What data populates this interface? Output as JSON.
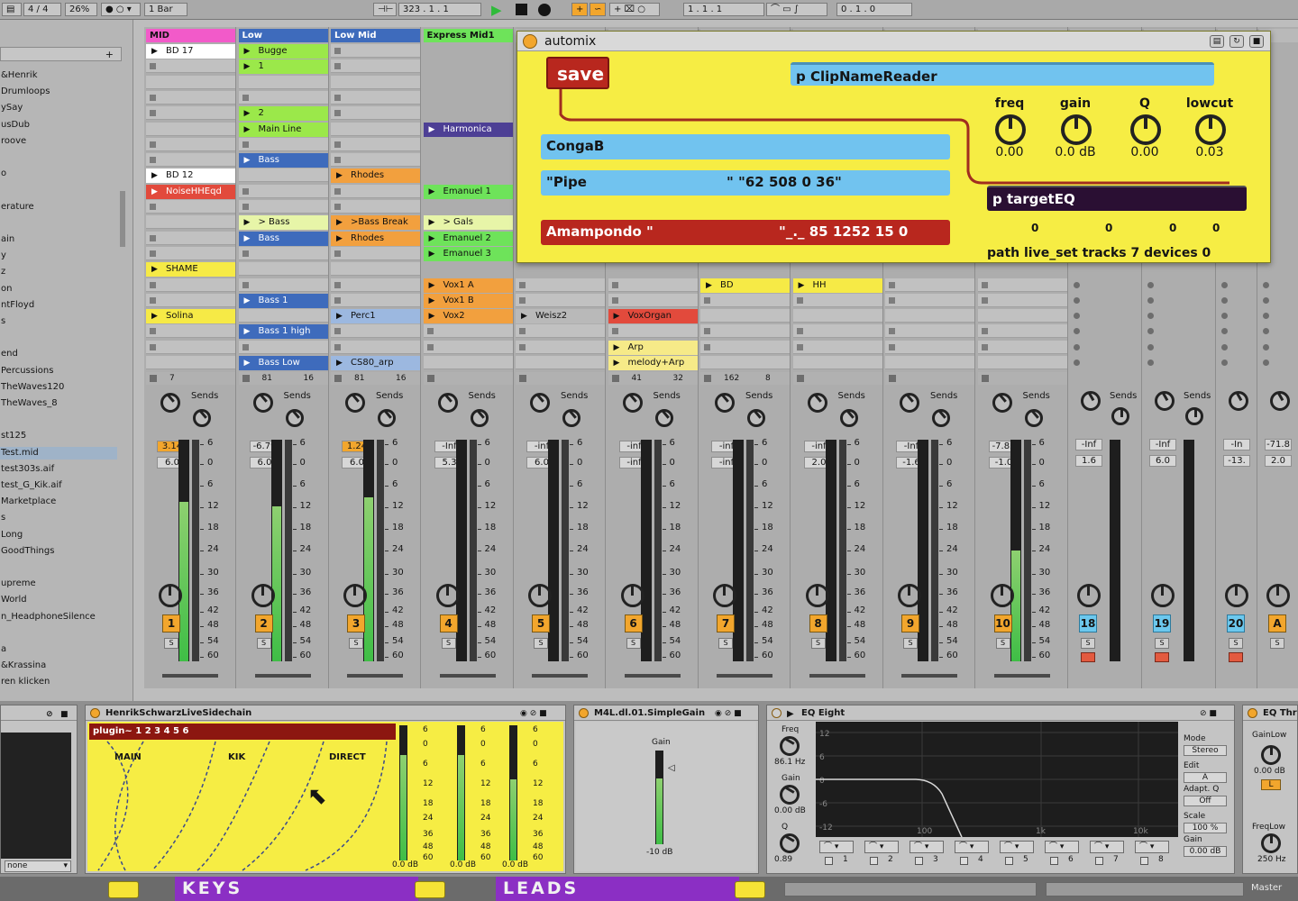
{
  "topbar": {
    "signature": "4 / 4",
    "zoom": "26%",
    "quantize": "1 Bar",
    "position": "323 .  1 .  1",
    "loop_start": "1 .  1 .  1",
    "loop_length": "0 .  1 .  0"
  },
  "browser": {
    "items": [
      "&Henrik",
      "Drumloops",
      "ySay",
      "usDub",
      "roove",
      "",
      "o",
      "",
      "erature",
      "",
      "ain",
      "y",
      "z",
      "on",
      "ntFloyd",
      "s",
      "",
      "end",
      "Percussions",
      "TheWaves120",
      "TheWaves_8",
      "",
      "st125",
      "Test.mid",
      "test303s.aif",
      "test_G_Kik.aif",
      "Marketplace",
      "s",
      "Long",
      "GoodThings",
      "",
      "upreme",
      "World",
      "n_HeadphoneSilence",
      "",
      "a",
      "&Krassina",
      "ren klicken"
    ],
    "selected_index": 23
  },
  "tracks": [
    {
      "name": "MID",
      "color": "#f25ac9",
      "clips": [
        {
          "row": 0,
          "label": "BD 17",
          "color": "#ffffff"
        },
        {
          "row": 8,
          "label": "BD 12",
          "color": "#ffffff"
        },
        {
          "row": 9,
          "label": "NoiseHHEqd",
          "color": "#e24a3c",
          "text": "#ffffff"
        },
        {
          "row": 14,
          "label": "SHAME",
          "color": "#f6ea46"
        },
        {
          "row": 17,
          "label": "Solina",
          "color": "#f6ea46"
        }
      ],
      "status": [
        "7",
        "",
        "",
        ""
      ],
      "vol": "3.14",
      "vol_orange": true,
      "send": "6.0",
      "num": "1",
      "meter": 0.72
    },
    {
      "name": "Low",
      "color": "#3e6bbc",
      "text": "#ffffff",
      "clips": [
        {
          "row": 0,
          "label": "Bugge",
          "color": "#9be84a"
        },
        {
          "row": 1,
          "label": "1",
          "color": "#9be84a"
        },
        {
          "row": 4,
          "label": "2",
          "color": "#9be84a"
        },
        {
          "row": 5,
          "label": "Main Line",
          "color": "#9be84a"
        },
        {
          "row": 7,
          "label": "Bass",
          "color": "#3e6bbc",
          "text": "#ffffff"
        },
        {
          "row": 11,
          "label": "> Bass",
          "color": "#e7f5a8"
        },
        {
          "row": 12,
          "label": "Bass",
          "color": "#3e6bbc",
          "text": "#ffffff"
        },
        {
          "row": 16,
          "label": "Bass 1",
          "color": "#3e6bbc",
          "text": "#ffffff"
        },
        {
          "row": 18,
          "label": "Bass 1 high",
          "color": "#3e6bbc",
          "text": "#ffffff"
        },
        {
          "row": 20,
          "label": "Bass Low",
          "color": "#3e6bbc",
          "text": "#ffffff"
        }
      ],
      "status": [
        "81",
        "16"
      ],
      "vol": "-6.79",
      "send": "6.0",
      "num": "2",
      "meter": 0.7
    },
    {
      "name": "Low Mid",
      "color": "#3e6bbc",
      "text": "#ffffff",
      "clips": [
        {
          "row": 8,
          "label": "Rhodes",
          "color": "#f2a03e"
        },
        {
          "row": 11,
          "label": ">Bass Break",
          "color": "#f2a03e"
        },
        {
          "row": 12,
          "label": "Rhodes",
          "color": "#f2a03e"
        },
        {
          "row": 17,
          "label": "Perc1",
          "color": "#9cb8e0"
        },
        {
          "row": 20,
          "label": "CS80_arp",
          "color": "#9cb8e0"
        }
      ],
      "status": [
        "81",
        "16"
      ],
      "vol": "1.24",
      "vol_orange": true,
      "send": "6.0",
      "num": "3",
      "meter": 0.74
    },
    {
      "name": "Express Mid1",
      "color": "#6ee35a",
      "clips": [
        {
          "row": 5,
          "label": "Harmonica",
          "color": "#4d3f95",
          "text": "#ffffff"
        },
        {
          "row": 9,
          "label": "Emanuel 1",
          "color": "#6ee35a"
        },
        {
          "row": 11,
          "label": "> Gals",
          "color": "#e7f5a8"
        },
        {
          "row": 12,
          "label": "Emanuel 2",
          "color": "#6ee35a"
        },
        {
          "row": 13,
          "label": "Emanuel 3",
          "color": "#6ee35a"
        },
        {
          "row": 15,
          "label": "Vox1 A",
          "color": "#f2a03e"
        },
        {
          "row": 16,
          "label": "Vox1 B",
          "color": "#f2a03e"
        },
        {
          "row": 17,
          "label": "Vox2",
          "color": "#f2a03e"
        }
      ],
      "status": [],
      "vol": "-Inf",
      "send": "5.3",
      "num": "4",
      "meter": 0
    },
    {
      "name": "",
      "color": "#b9b9b9",
      "clips": [
        {
          "row": 17,
          "label": "Weisz2",
          "color": "#b9b9b9"
        }
      ],
      "status": [],
      "vol": "-inf",
      "send": "6.0",
      "num": "5",
      "meter": 0
    },
    {
      "name": "",
      "color": "#b9b9b9",
      "clips": [
        {
          "row": 17,
          "label": "VoxOrgan",
          "color": "#e24a3c"
        },
        {
          "row": 19,
          "label": "Arp",
          "color": "#f6ea88"
        },
        {
          "row": 20,
          "label": "melody+Arp",
          "color": "#f6ea88"
        }
      ],
      "status": [
        "41",
        "32"
      ],
      "vol": "-inf",
      "send": "-inf",
      "num": "6",
      "meter": 0
    },
    {
      "name": "",
      "color": "#b9b9b9",
      "clips": [
        {
          "row": 15,
          "label": "BD",
          "color": "#f6ea46"
        }
      ],
      "status": [
        "162",
        "8"
      ],
      "vol": "-inf",
      "send": "-inf",
      "num": "7",
      "meter": 0
    },
    {
      "name": "",
      "color": "#b9b9b9",
      "clips": [
        {
          "row": 15,
          "label": "HH",
          "color": "#f6ea46"
        }
      ],
      "status": [],
      "vol": "-inf",
      "send": "2.0",
      "num": "8",
      "meter": 0
    },
    {
      "name": "",
      "color": "#b9b9b9",
      "clips": [],
      "status": [],
      "vol": "-Inf",
      "send": "-1.6",
      "num": "9",
      "meter": 0
    },
    {
      "name": "",
      "color": "#b9b9b9",
      "clips": [],
      "status": [],
      "vol": "-7.85",
      "send": "-1.0",
      "num": "10",
      "meter": 0.5
    }
  ],
  "return_tracks": [
    {
      "vol": "-Inf",
      "send": "1.6",
      "num": "18"
    },
    {
      "vol": "-Inf",
      "send": "6.0",
      "num": "19"
    },
    {
      "vol": "-In",
      "send": "-13.",
      "num": "20"
    },
    {
      "vol": "-71.8",
      "send": "2.0",
      "num": "A"
    }
  ],
  "mixer": {
    "sends_label": "Sends",
    "scale": [
      "6",
      "0",
      "6",
      "12",
      "18",
      "24",
      "30",
      "36",
      "42",
      "48",
      "54",
      "60"
    ],
    "solo_label": "S"
  },
  "automix": {
    "title": "automix",
    "save_label": "save",
    "clipname_reader": "p ClipNameReader",
    "field1": "CongaB",
    "field2_left": "\"Pipe",
    "field2_right": "\" \"62 508 0 36\"",
    "field3_left": "Amampondo \"",
    "field3_right": "\"_._ 85 1252 15 0",
    "target_eq": "p targetEQ",
    "knobs": [
      {
        "label": "freq",
        "value": "0.00"
      },
      {
        "label": "gain",
        "value": "0.0 dB"
      },
      {
        "label": "Q",
        "value": "0.00"
      },
      {
        "label": "lowcut",
        "value": "0.03"
      }
    ],
    "zeros": [
      "0",
      "0",
      "0",
      "0"
    ],
    "path": "path live_set tracks 7 devices 0"
  },
  "devices": {
    "sidechain_title": "HenrikSchwarzLiveSidechain",
    "plugin_label": "plugin~ 1 2 3 4 5 6",
    "sc_labels": [
      "MAIN",
      "KIK",
      "DIRECT"
    ],
    "sc_db": [
      "0.0 dB",
      "0.0 dB",
      "0.0 dB"
    ],
    "sc_scale": [
      "6",
      "0",
      "6",
      "12",
      "18",
      "24",
      "36",
      "48",
      "60"
    ],
    "dropdown": "none",
    "simplegain_title": "M4L.dl.01.SimpleGain",
    "gain_label": "Gain",
    "gain_value": "-10 dB",
    "eq_title": "EQ Eight",
    "eq_params": [
      {
        "label": "Freq",
        "value": "86.1 Hz"
      },
      {
        "label": "Gain",
        "value": "0.00 dB"
      },
      {
        "label": "Q",
        "value": "0.89"
      }
    ],
    "eq_grid_y": [
      "12",
      "6",
      "0",
      "-6",
      "-12"
    ],
    "eq_grid_x": [
      "100",
      "1k",
      "10k"
    ],
    "eq_bands": [
      "1",
      "2",
      "3",
      "4",
      "5",
      "6",
      "7",
      "8"
    ],
    "eq_right": {
      "mode_label": "Mode",
      "mode_value": "Stereo",
      "edit_label": "Edit",
      "edit_value": "A",
      "adapt_label": "Adapt. Q",
      "adapt_value": "Off",
      "scale_label": "Scale",
      "scale_value": "100 %",
      "gain_label": "Gain",
      "gain_value": "0.00 dB"
    },
    "eq3_title": "EQ Thre",
    "eq3_gainlow_label": "GainLow",
    "eq3_gainlow_value": "0.00 dB",
    "eq3_l": "L",
    "eq3_freqlow_label": "FreqLow",
    "eq3_freqlow_value": "250 Hz"
  },
  "groups": [
    "KEYS",
    "LEADS"
  ],
  "master_label": "Master"
}
